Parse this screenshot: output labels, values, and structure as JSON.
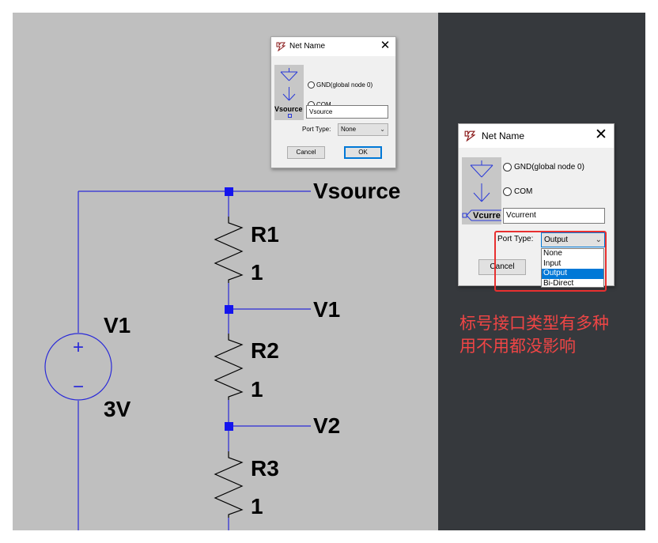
{
  "schematic": {
    "net_labels": {
      "vsource": "Vsource",
      "v1": "V1",
      "v2": "V2"
    },
    "resistors": [
      {
        "name": "R1",
        "value": "1"
      },
      {
        "name": "R2",
        "value": "1"
      },
      {
        "name": "R3",
        "value": "1"
      }
    ],
    "source": {
      "name": "V1",
      "value": "3V",
      "plus": "+",
      "minus": "−"
    },
    "colors": {
      "wire": "#2a2ad8",
      "junction": "#1414ee",
      "component": "#000000",
      "background": "#bfbfbf"
    }
  },
  "dialog_vsource": {
    "title": "Net Name",
    "close_glyph": "✕",
    "options": [
      {
        "label": "GND(global node 0)"
      },
      {
        "label": "COM"
      }
    ],
    "preview_label": "Vsource",
    "name_value": "Vsource",
    "port_type_label": "Port Type:",
    "port_type_value": "None",
    "cancel_label": "Cancel",
    "ok_label": "OK"
  },
  "dialog_vcurrent": {
    "title": "Net Name",
    "close_glyph": "✕",
    "options": [
      {
        "label": "GND(global node 0)"
      },
      {
        "label": "COM"
      }
    ],
    "preview_label": "Vcurre",
    "name_value": "Vcurrent",
    "port_type_label": "Port Type:",
    "port_type_value": "Output",
    "cancel_label": "Cancel",
    "port_type_options": [
      "None",
      "Input",
      "Output",
      "Bi-Direct"
    ],
    "selected_option": "Output"
  },
  "annotation": {
    "line1": "标号接口类型有多种",
    "line2": "用不用都没影响",
    "color": "#f04545"
  }
}
